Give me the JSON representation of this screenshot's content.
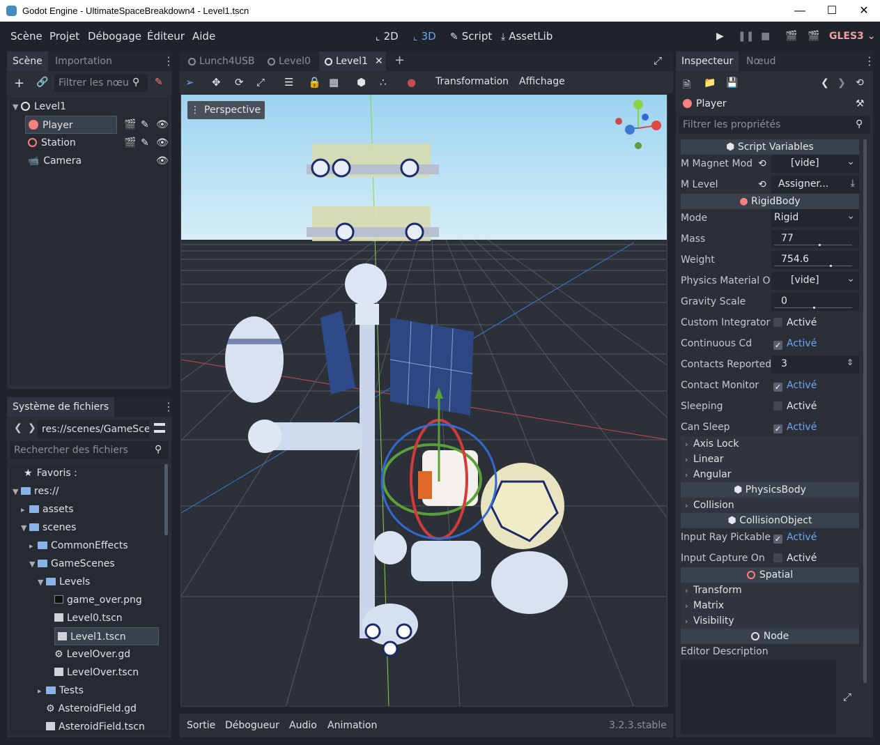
{
  "window": {
    "title": "Godot Engine - UltimateSpaceBreakdown4 - Level1.tscn",
    "minimize_icon": "minimize-icon",
    "maximize_icon": "maximize-icon",
    "close_icon": "close-icon"
  },
  "menubar": {
    "items": [
      "Scène",
      "Projet",
      "Débogage",
      "Éditeur",
      "Aide"
    ],
    "modes": [
      {
        "label": "2D",
        "icon": "2d-icon"
      },
      {
        "label": "3D",
        "icon": "3d-icon"
      },
      {
        "label": "Script",
        "icon": "script-icon"
      },
      {
        "label": "AssetLib",
        "icon": "assetlib-icon"
      }
    ],
    "renderer": "GLES3"
  },
  "scene_dock": {
    "tabs": [
      "Scène",
      "Importation"
    ],
    "filter_placeholder": "Filtrer les nœu",
    "nodes": [
      {
        "label": "Level1",
        "icon": "spatial-node-icon"
      },
      {
        "label": "Player",
        "icon": "rigidbody-icon"
      },
      {
        "label": "Station",
        "icon": "spatial-node-icon"
      },
      {
        "label": "Camera",
        "icon": "camera-icon"
      }
    ]
  },
  "filesystem_dock": {
    "title": "Système de fichiers",
    "path": "res://scenes/GameSce",
    "search_placeholder": "Rechercher des fichiers",
    "items": [
      {
        "label": "Favoris :",
        "icon": "star-icon"
      },
      {
        "label": "res://",
        "icon": "folder-icon"
      },
      {
        "label": "assets",
        "icon": "folder-icon"
      },
      {
        "label": "scenes",
        "icon": "folder-icon"
      },
      {
        "label": "CommonEffects",
        "icon": "folder-icon"
      },
      {
        "label": "GameScenes",
        "icon": "folder-icon"
      },
      {
        "label": "Levels",
        "icon": "folder-icon"
      },
      {
        "label": "game_over.png",
        "icon": "image-icon"
      },
      {
        "label": "Level0.tscn",
        "icon": "scene-icon"
      },
      {
        "label": "Level1.tscn",
        "icon": "scene-icon"
      },
      {
        "label": "LevelOver.gd",
        "icon": "gear-icon"
      },
      {
        "label": "LevelOver.tscn",
        "icon": "scene-icon"
      },
      {
        "label": "Tests",
        "icon": "folder-icon"
      },
      {
        "label": "AsteroidField.gd",
        "icon": "gear-icon"
      },
      {
        "label": "AsteroidField.tscn",
        "icon": "scene-icon"
      }
    ]
  },
  "editor_tabs": [
    "Lunch4USB",
    "Level0",
    "Level1"
  ],
  "viewport_toolbar": {
    "transform_menu": "Transformation",
    "view_menu": "Affichage",
    "perspective_label": "Perspective"
  },
  "bottom_panel": {
    "tabs": [
      "Sortie",
      "Débogueur",
      "Audio",
      "Animation"
    ],
    "version": "3.2.3.stable"
  },
  "inspector": {
    "tabs": [
      "Inspecteur",
      "Nœud"
    ],
    "object_name": "Player",
    "filter_placeholder": "Filtrer les propriétés",
    "sections": {
      "script_variables": "Script Variables",
      "rigidbody": "RigidBody",
      "physicsbody": "PhysicsBody",
      "collisionobject": "CollisionObject",
      "spatial": "Spatial",
      "node": "Node"
    },
    "props": {
      "magnet_mod": {
        "label": "M Magnet Mod",
        "value": "[vide]"
      },
      "level": {
        "label": "M Level",
        "value": "Assigner..."
      },
      "mode": {
        "label": "Mode",
        "value": "Rigid"
      },
      "mass": {
        "label": "Mass",
        "value": "77"
      },
      "weight": {
        "label": "Weight",
        "value": "754.6"
      },
      "physics_material": {
        "label": "Physics Material O",
        "value": "[vide]"
      },
      "gravity_scale": {
        "label": "Gravity Scale",
        "value": "0"
      },
      "custom_integrator": {
        "label": "Custom Integrator",
        "value": "Activé",
        "checked": false
      },
      "continuous_cd": {
        "label": "Continuous Cd",
        "value": "Activé",
        "checked": true
      },
      "contacts_reported": {
        "label": "Contacts Reported",
        "value": "3"
      },
      "contact_monitor": {
        "label": "Contact Monitor",
        "value": "Activé",
        "checked": true
      },
      "sleeping": {
        "label": "Sleeping",
        "value": "Activé",
        "checked": false
      },
      "can_sleep": {
        "label": "Can Sleep",
        "value": "Activé",
        "checked": true
      },
      "input_ray_pickable": {
        "label": "Input Ray Pickable",
        "value": "Activé",
        "checked": true
      },
      "input_capture_on": {
        "label": "Input Capture On",
        "value": "Activé",
        "checked": false
      },
      "editor_description": {
        "label": "Editor Description"
      }
    },
    "groups": {
      "axis_lock": "Axis Lock",
      "linear": "Linear",
      "angular": "Angular",
      "collision": "Collision",
      "transform": "Transform",
      "matrix": "Matrix",
      "visibility": "Visibility"
    }
  },
  "colors": {
    "accent": "#6ea5f5",
    "panel": "#2a2f38",
    "background": "#1f232b",
    "renderer": "#f0a0a0"
  }
}
